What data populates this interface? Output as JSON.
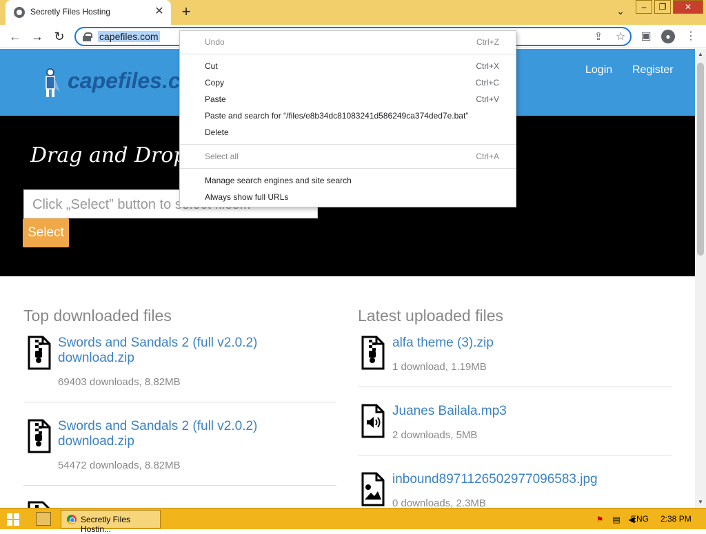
{
  "browser": {
    "tab_title": "Secretly Files Hosting",
    "url": "capefiles.com"
  },
  "site": {
    "logo_text": "capefiles.c",
    "nav": {
      "login": "Login",
      "register": "Register"
    },
    "hero_title": "Drag and Drop f",
    "input_placeholder": "Click „Select” button to select files...",
    "select_label": "Select",
    "top_title": "Top downloaded files",
    "latest_title": "Latest uploaded files",
    "top_files": [
      {
        "name_line1": "Swords and Sandals 2 (full v2.0.2)",
        "name_line2": "download.zip",
        "meta": "69403 downloads, 8.82MB"
      },
      {
        "name_line1": "Swords and Sandals 2 (full v2.0.2)",
        "name_line2": "download.zip",
        "meta": "54472 downloads, 8.82MB"
      }
    ],
    "latest_files": [
      {
        "name": "alfa theme (3).zip",
        "meta": "1 download, 1.19MB"
      },
      {
        "name": "Juanes Bailala.mp3",
        "meta": "2 downloads, 5MB"
      },
      {
        "name": "inbound8971126502977096583.jpg",
        "meta": "0 downloads, 2.3MB"
      }
    ]
  },
  "context_menu": {
    "items": [
      {
        "label": "Undo",
        "shortcut": "Ctrl+Z",
        "disabled": true
      },
      {
        "label": "Cut",
        "shortcut": "Ctrl+X"
      },
      {
        "label": "Copy",
        "shortcut": "Ctrl+C"
      },
      {
        "label": "Paste",
        "shortcut": "Ctrl+V"
      },
      {
        "label": "Paste and search for “/files/e8b34dc81083241d586249ca374ded7e.bat”",
        "shortcut": ""
      },
      {
        "label": "Delete",
        "shortcut": ""
      },
      {
        "label": "Select all",
        "shortcut": "Ctrl+A",
        "disabled": true
      },
      {
        "label": "Manage search engines and site search",
        "shortcut": ""
      },
      {
        "label": "Always show full URLs",
        "shortcut": ""
      }
    ]
  },
  "taskbar": {
    "chrome_label": "Secretly Files Hostin...",
    "language": "ENG",
    "time": "2:38 PM"
  },
  "colors": {
    "tab_bar": "#f2cf6a",
    "site_header": "#3b98db",
    "select_button": "#f0a849",
    "link": "#3b82c4",
    "taskbar": "#f2b41b"
  }
}
